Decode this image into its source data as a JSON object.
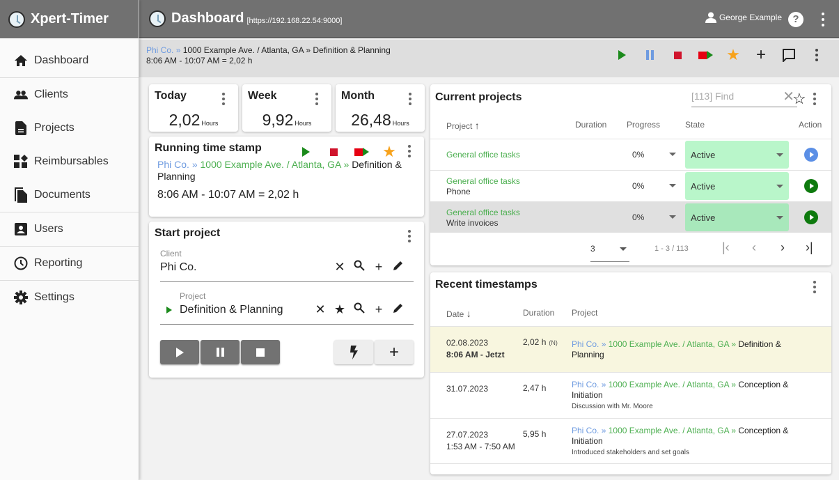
{
  "app": {
    "title": "Xpert-Timer"
  },
  "header": {
    "page_title": "Dashboard",
    "url": "[https://192.168.22.54:9000]",
    "user_name": "George Example",
    "help_label": "?"
  },
  "sidebar": {
    "items": [
      {
        "label": "Dashboard",
        "icon": "home-icon"
      },
      {
        "label": "Clients",
        "icon": "people-icon"
      },
      {
        "label": "Projects",
        "icon": "document-icon"
      },
      {
        "label": "Reimbursables",
        "icon": "widgets-icon"
      },
      {
        "label": "Documents",
        "icon": "documents-icon"
      },
      {
        "label": "Users",
        "icon": "user-box-icon"
      },
      {
        "label": "Reporting",
        "icon": "clock-icon"
      },
      {
        "label": "Settings",
        "icon": "gear-icon"
      }
    ]
  },
  "subbar": {
    "client": "Phi Co.",
    "sep": "»",
    "address": "1000 Example Ave. / Atlanta, GA",
    "project": "Definition & Planning",
    "time_range": "8:06 AM - 10:07 AM  = 2,02 h",
    "actions": [
      "play",
      "pause",
      "stop",
      "record-switch",
      "favorite",
      "add",
      "comment",
      "more"
    ]
  },
  "stats": [
    {
      "title": "Today",
      "value": "2,02",
      "unit": "Hours"
    },
    {
      "title": "Week",
      "value": "9,92",
      "unit": "Hours"
    },
    {
      "title": "Month",
      "value": "26,48",
      "unit": "Hours"
    }
  ],
  "running": {
    "title": "Running time stamp",
    "client": "Phi Co.",
    "sep": "»",
    "address": "1000 Example Ave. / Atlanta, GA",
    "project": "Definition & Planning",
    "time": "8:06 AM - 10:07 AM  = 2,02 h"
  },
  "start_project": {
    "title": "Start project",
    "client_label": "Client",
    "client_value": "Phi Co.",
    "project_label": "Project",
    "project_value": "Definition & Planning"
  },
  "current_projects": {
    "title": "Current projects",
    "find_placeholder": "[113] Find",
    "columns": [
      "Project",
      "Duration",
      "Progress",
      "State",
      "Action"
    ],
    "rows": [
      {
        "name": "General office tasks",
        "sub": "",
        "progress": "0%",
        "state": "Active",
        "action_color": "#5b8fe6"
      },
      {
        "name": "General office tasks",
        "sub": "Phone",
        "progress": "0%",
        "state": "Active",
        "action_color": "#0e7a0e"
      },
      {
        "name": "General office tasks",
        "sub": "Write invoices",
        "progress": "0%",
        "state": "Active",
        "action_color": "#0e7a0e"
      }
    ],
    "page_size": "3",
    "range": "1 - 3 / 113"
  },
  "recent": {
    "title": "Recent timestamps",
    "columns": [
      "Date",
      "Duration",
      "Project"
    ],
    "rows": [
      {
        "date": "02.08.2023",
        "time": "8:06 AM - Jetzt",
        "duration": "2,02 h",
        "flag": "(N)",
        "client": "Phi Co.",
        "address": "1000 Example Ave. / Atlanta, GA",
        "project": "Definition & Planning",
        "note": ""
      },
      {
        "date": "31.07.2023",
        "time": "",
        "duration": "2,47 h",
        "flag": "",
        "client": "Phi Co.",
        "address": "1000 Example Ave. / Atlanta, GA",
        "project": "Conception & Initiation",
        "note": "Discussion with Mr. Moore"
      },
      {
        "date": "27.07.2023",
        "time": "1:53 AM - 7:50 AM",
        "duration": "5,95 h",
        "flag": "",
        "client": "Phi Co.",
        "address": "1000 Example Ave. / Atlanta, GA",
        "project": "Conception & Initiation",
        "note": "Introduced stakeholders and set goals"
      }
    ]
  },
  "colors": {
    "header": "#717171",
    "accent_green": "#4caf50",
    "accent_blue": "#6e9be0",
    "state_bg": "#b9f6ca",
    "highlight_row": "#f8f6df"
  }
}
